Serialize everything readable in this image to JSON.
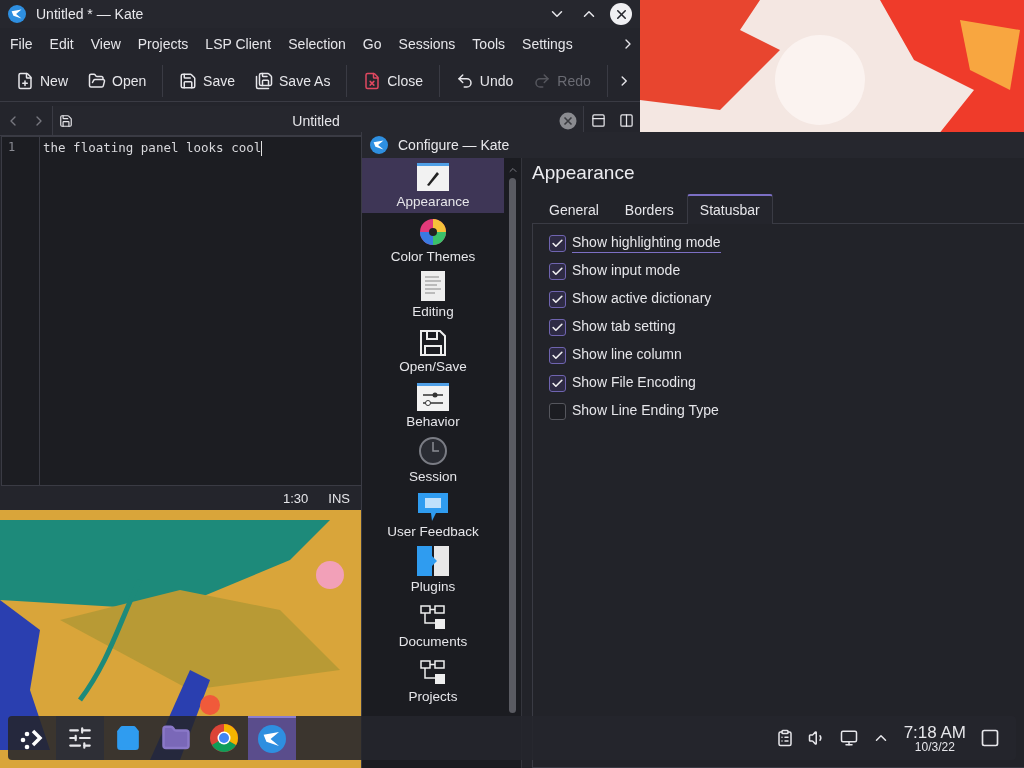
{
  "kate_window": {
    "title": "Untitled * — Kate",
    "menu": [
      "File",
      "Edit",
      "View",
      "Projects",
      "LSP Client",
      "Selection",
      "Go",
      "Sessions",
      "Tools",
      "Settings"
    ],
    "toolbar": [
      {
        "label": "New",
        "disabled": false
      },
      {
        "label": "Open",
        "disabled": false
      },
      {
        "label": "Save",
        "disabled": false
      },
      {
        "label": "Save As",
        "disabled": false
      },
      {
        "label": "Close",
        "disabled": false
      },
      {
        "label": "Undo",
        "disabled": false
      },
      {
        "label": "Redo",
        "disabled": true
      }
    ],
    "tab": {
      "title": "Untitled"
    },
    "editor": {
      "lines": [
        {
          "number": "1",
          "text": "the floating panel looks cool"
        }
      ]
    },
    "status_bar": {
      "position": "1:30",
      "mode": "INS"
    }
  },
  "configure_window": {
    "title": "Configure — Kate",
    "sidebar": [
      {
        "label": "Appearance",
        "selected": true
      },
      {
        "label": "Color Themes",
        "selected": false
      },
      {
        "label": "Editing",
        "selected": false
      },
      {
        "label": "Open/Save",
        "selected": false
      },
      {
        "label": "Behavior",
        "selected": false
      },
      {
        "label": "Session",
        "selected": false
      },
      {
        "label": "User Feedback",
        "selected": false
      },
      {
        "label": "Plugins",
        "selected": false
      },
      {
        "label": "Documents",
        "selected": false
      },
      {
        "label": "Projects",
        "selected": false
      }
    ],
    "heading": "Appearance",
    "tabs": [
      {
        "label": "General",
        "selected": false
      },
      {
        "label": "Borders",
        "selected": false
      },
      {
        "label": "Statusbar",
        "selected": true
      }
    ],
    "options": [
      {
        "label": "Show highlighting mode",
        "checked": true,
        "focused": true
      },
      {
        "label": "Show input mode",
        "checked": true,
        "focused": false
      },
      {
        "label": "Show active dictionary",
        "checked": true,
        "focused": false
      },
      {
        "label": "Show tab setting",
        "checked": true,
        "focused": false
      },
      {
        "label": "Show line column",
        "checked": true,
        "focused": false
      },
      {
        "label": "Show File Encoding",
        "checked": true,
        "focused": false
      },
      {
        "label": "Show Line Ending Type",
        "checked": false,
        "focused": false
      }
    ]
  },
  "taskbar": {
    "apps": [
      {
        "kind": "launcher",
        "selected": false
      },
      {
        "kind": "settings",
        "selected": false
      },
      {
        "kind": "store",
        "selected": false
      },
      {
        "kind": "files",
        "selected": false
      },
      {
        "kind": "browser",
        "selected": false
      },
      {
        "kind": "editor",
        "selected": true
      }
    ],
    "clock": {
      "time": "7:18 AM",
      "date": "10/3/22"
    }
  }
}
